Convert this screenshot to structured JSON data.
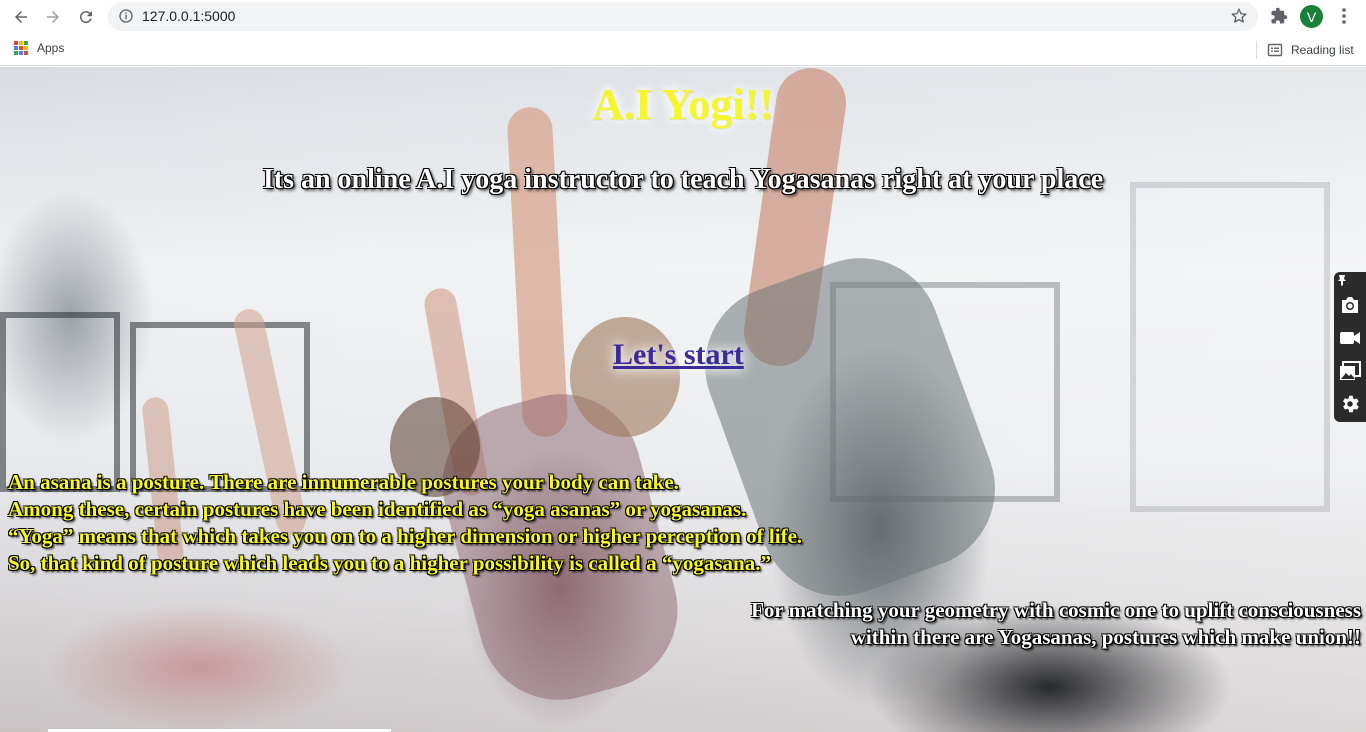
{
  "browser": {
    "url": "127.0.0.1:5000",
    "avatar_letter": "V",
    "bookmarks": {
      "apps_label": "Apps",
      "reading_list_label": "Reading list"
    },
    "icons": [
      "back-icon",
      "forward-icon",
      "reload-icon",
      "info-icon",
      "star-icon",
      "extensions-icon",
      "menu-icon",
      "apps-grid-icon",
      "reading-list-icon"
    ]
  },
  "page": {
    "title": "A.I Yogi!!",
    "subtitle": "Its an online A.I yoga instructor to teach Yogasanas right at your place",
    "start_link": "Let's start",
    "about_lines": [
      "An asana is a posture. There are innumerable postures your body can take.",
      "Among these, certain postures have been identified as “yoga asanas” or yogasanas.",
      "“Yoga” means that which takes you on to a higher dimension or higher perception of life.",
      "So, that kind of posture which leads you to a higher possibility is called a “yogasana.”"
    ],
    "cosmic_lines": [
      "For matching your geometry with cosmic one to uplift consciousness",
      "within there are Yogasanas, postures which make union!!"
    ]
  },
  "side_widget": {
    "icons": [
      "pin-icon",
      "camera-icon",
      "video-icon",
      "gallery-icon",
      "settings-icon"
    ]
  },
  "colors": {
    "title": "#f5f530",
    "about_text": "#f8f820",
    "link": "#3b2b9a",
    "avatar": "#188038"
  }
}
